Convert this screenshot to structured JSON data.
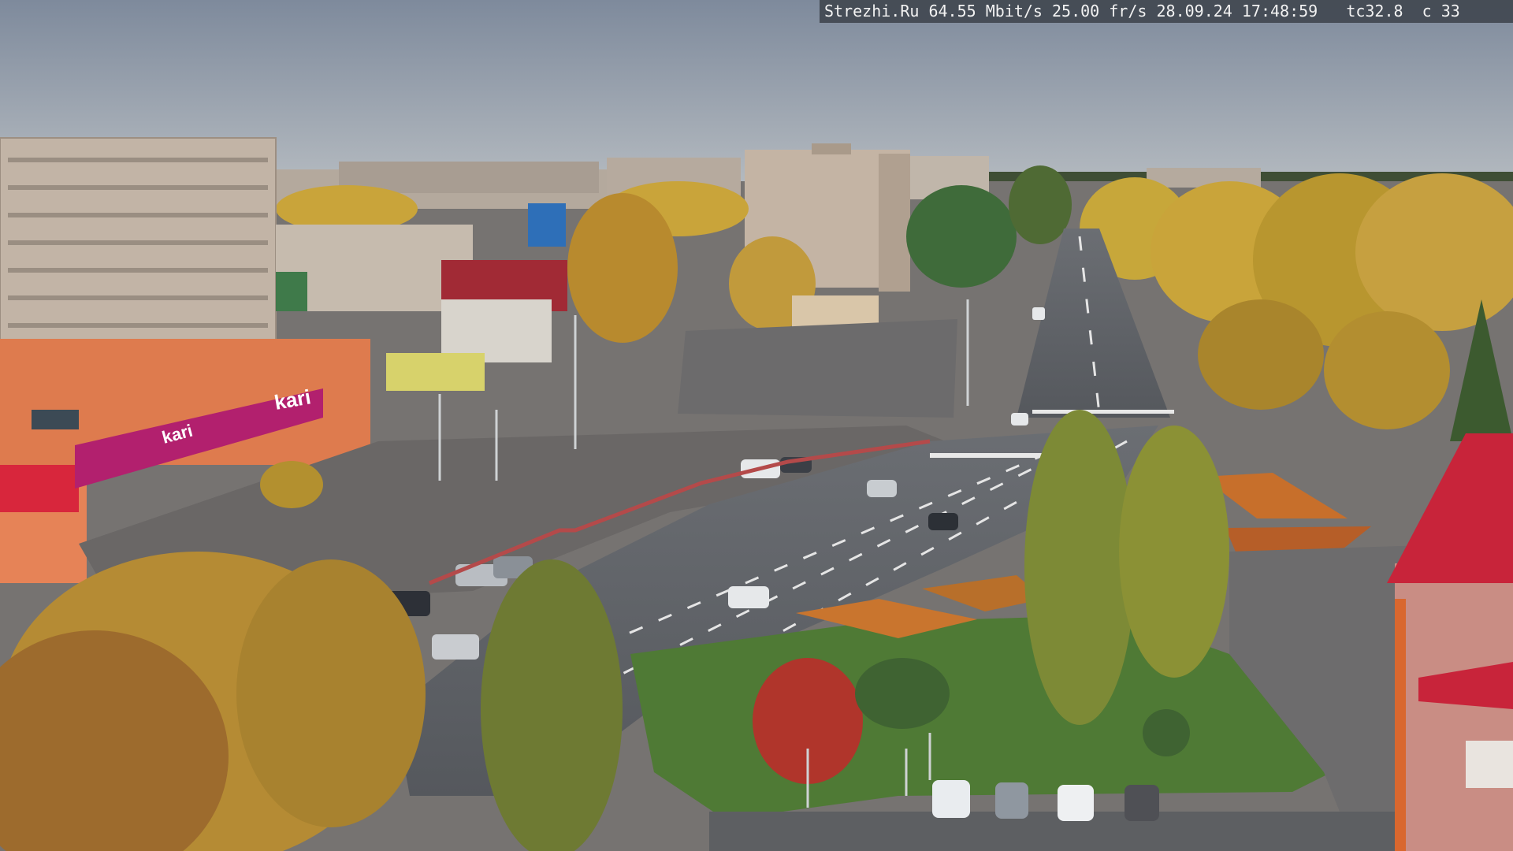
{
  "overlay": {
    "site": "Strezhi.Ru",
    "bitrate": "64.55 Mbit/s",
    "framerate": "25.00 fr/s",
    "date": "28.09.24",
    "time": "17:48:59",
    "tc": "tc32.8",
    "channel": "c 33"
  },
  "signs": {
    "store_brand": "kari",
    "store_brand_small": "kari"
  },
  "colors": {
    "sky_top": "#8b96a6",
    "sky_bottom": "#aab3bd",
    "road": "#5e6166",
    "foliage_yellow": "#c9a43a",
    "foliage_green": "#4f6a34",
    "store_magenta": "#b2206e",
    "roof_red": "#c8243a"
  }
}
